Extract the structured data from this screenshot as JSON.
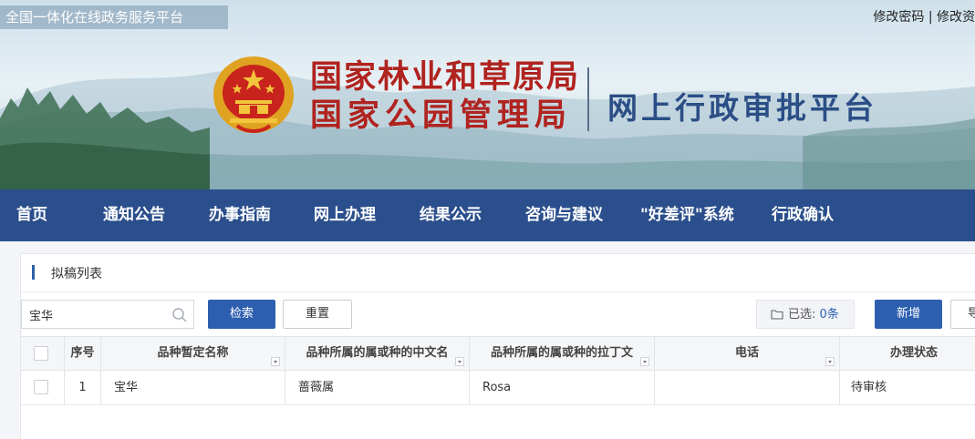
{
  "header": {
    "portal_tag": "全国一体化在线政务服务平台",
    "links": [
      "修改密码",
      "修改资"
    ],
    "link_separator": " | ",
    "org_name_1": "国家林业和草原局",
    "org_name_2": "国家公园管理局",
    "platform_name": "网上行政审批平台"
  },
  "nav": {
    "items": [
      "首页",
      "通知公告",
      "办事指南",
      "网上办理",
      "结果公示",
      "咨询与建议",
      "\"好差评\"系统",
      "行政确认"
    ]
  },
  "panel": {
    "title": "拟稿列表"
  },
  "toolbar": {
    "search_value": "宝华",
    "search_label": "检索",
    "reset_label": "重置",
    "selected_label": "已选: ",
    "selected_count": "0条",
    "add_label": "新增",
    "next_label": "导"
  },
  "table": {
    "columns": [
      "序号",
      "品种暂定名称",
      "品种所属的属或种的中文名",
      "品种所属的属或种的拉丁文",
      "电话",
      "办理状态"
    ],
    "rows": [
      {
        "index": "1",
        "name": "宝华",
        "genus_cn": "蔷薇属",
        "genus_latin": "Rosa",
        "phone": "",
        "status": "待审核"
      }
    ]
  },
  "colors": {
    "nav_bg": "#2b4f8c",
    "primary": "#2d5fb0",
    "org_red": "#b0231f",
    "platform_blue": "#2b4e86"
  }
}
